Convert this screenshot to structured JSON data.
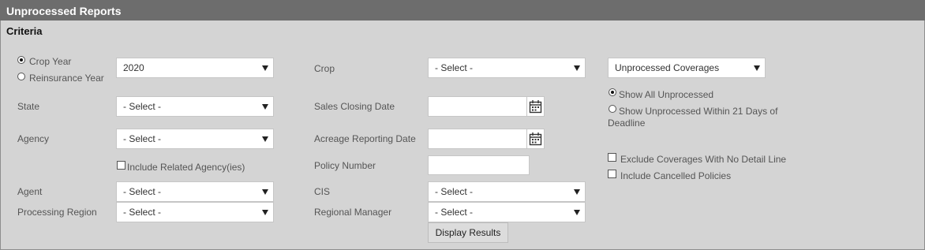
{
  "header": {
    "title": "Unprocessed Reports"
  },
  "criteria": {
    "title": "Criteria",
    "year_type": {
      "crop_year": "Crop Year",
      "reinsurance_year": "Reinsurance Year",
      "selected": "crop_year"
    },
    "year_value": "2020",
    "state": {
      "label": "State",
      "value": "- Select -"
    },
    "agency": {
      "label": "Agency",
      "value": "- Select -"
    },
    "include_related_agencies": {
      "label": "Include Related Agency(ies)",
      "checked": false
    },
    "agent": {
      "label": "Agent",
      "value": "- Select -"
    },
    "processing_region": {
      "label": "Processing Region",
      "value": "- Select -"
    },
    "crop": {
      "label": "Crop",
      "value": "- Select -"
    },
    "sales_closing_date": {
      "label": "Sales Closing Date",
      "value": ""
    },
    "acreage_reporting_date": {
      "label": "Acreage Reporting Date",
      "value": ""
    },
    "policy_number": {
      "label": "Policy Number",
      "value": ""
    },
    "cis": {
      "label": "CIS",
      "value": "- Select -"
    },
    "regional_manager": {
      "label": "Regional Manager",
      "value": "- Select -"
    },
    "display_results": "Display Results",
    "coverage_type": {
      "value": "Unprocessed Coverages"
    },
    "unprocessed_filter": {
      "show_all": "Show All Unprocessed",
      "within_days_line1": "Show Unprocessed Within 21 Days of",
      "within_days_line2": "Deadline",
      "selected": "show_all"
    },
    "exclude_no_detail": {
      "label": "Exclude Coverages With No Detail Line",
      "checked": false
    },
    "include_cancelled": {
      "label": "Include Cancelled Policies",
      "checked": false
    }
  },
  "icons": {
    "calendar": "calendar-icon",
    "dropdown": "chevron-down-icon"
  }
}
